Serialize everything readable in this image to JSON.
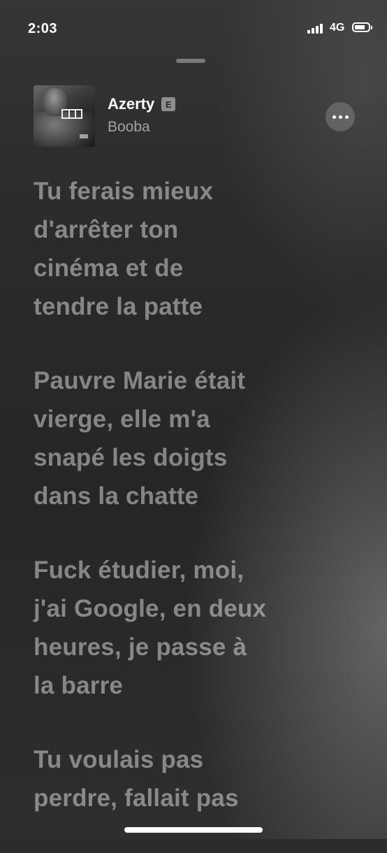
{
  "status_bar": {
    "time": "2:03",
    "network": "4G",
    "signal_bars_filled": 4,
    "battery_level": 0.65
  },
  "now_playing": {
    "song_title": "Azerty",
    "explicit_badge": "E",
    "artist": "Booba",
    "more_button_icon": "ellipsis-icon"
  },
  "lyrics": [
    "Tu ferais mieux\nd'arrêter ton\ncinéma et de\ntendre la patte",
    "Pauvre Marie était\nvierge, elle m'a\nsnapé les doigts\ndans la chatte",
    "Fuck étudier, moi,\nj'ai Google, en deux\nheures, je passe à\nla barre",
    "Tu voulais pas\nperdre, fallait pas"
  ],
  "colors": {
    "lyric_text": "#9a9a9a",
    "title_text": "#ffffff",
    "artist_text": "#8c8c8c",
    "background": "#2c2c2c"
  }
}
